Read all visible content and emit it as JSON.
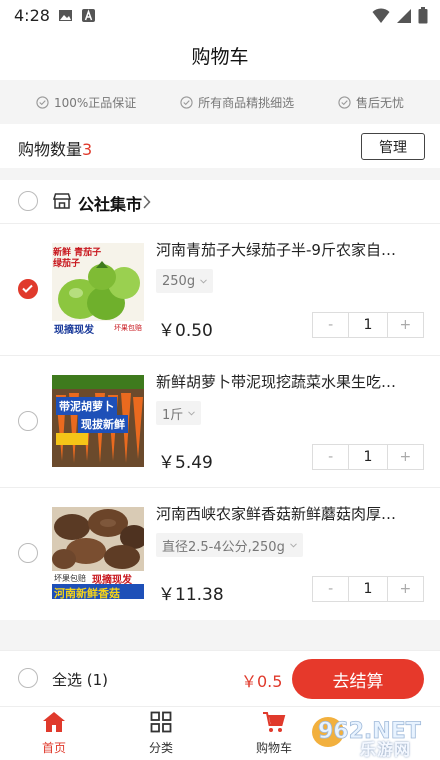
{
  "status_bar": {
    "time": "4:28"
  },
  "header": {
    "title": "购物车"
  },
  "guarantees": [
    "100%正品保证",
    "所有商品精挑细选",
    "售后无忧"
  ],
  "cart_count": {
    "label": "购物数量",
    "count": "3"
  },
  "manage_label": "管理",
  "shop": {
    "name": "公社集市"
  },
  "items": [
    {
      "title": "河南青茄子大绿茄子半-9斤农家自…",
      "spec": "250g",
      "price": "￥0.50",
      "qty": "1",
      "checked": true,
      "thumb_texts": [
        "新鲜 青茄子",
        "绿茄子",
        "现摘现发",
        "坏果包赔"
      ]
    },
    {
      "title": "新鲜胡萝卜带泥现挖蔬菜水果生吃…",
      "spec": "1斤",
      "price": "￥5.49",
      "qty": "1",
      "checked": false,
      "thumb_texts": [
        "带泥胡萝卜",
        "现拔新鲜"
      ]
    },
    {
      "title": "河南西峡农家鲜香菇新鲜蘑菇肉厚…",
      "spec": "直径2.5-4公分,250g",
      "price": "￥11.38",
      "qty": "1",
      "checked": false,
      "thumb_texts": [
        "坏果包赔",
        "现摘现发",
        "河南新鲜香菇"
      ]
    }
  ],
  "checkout": {
    "select_all": "全选 (1)",
    "total": "￥0.5",
    "button": "去结算"
  },
  "tabs": [
    {
      "label": "首页",
      "icon": "home-icon"
    },
    {
      "label": "分类",
      "icon": "grid-icon"
    },
    {
      "label": "购物车",
      "icon": "cart-icon"
    }
  ],
  "watermark": {
    "text": "962.NET",
    "sub": "乐游网"
  },
  "colors": {
    "accent": "#e03a2c",
    "background": "#f4f4f4"
  }
}
